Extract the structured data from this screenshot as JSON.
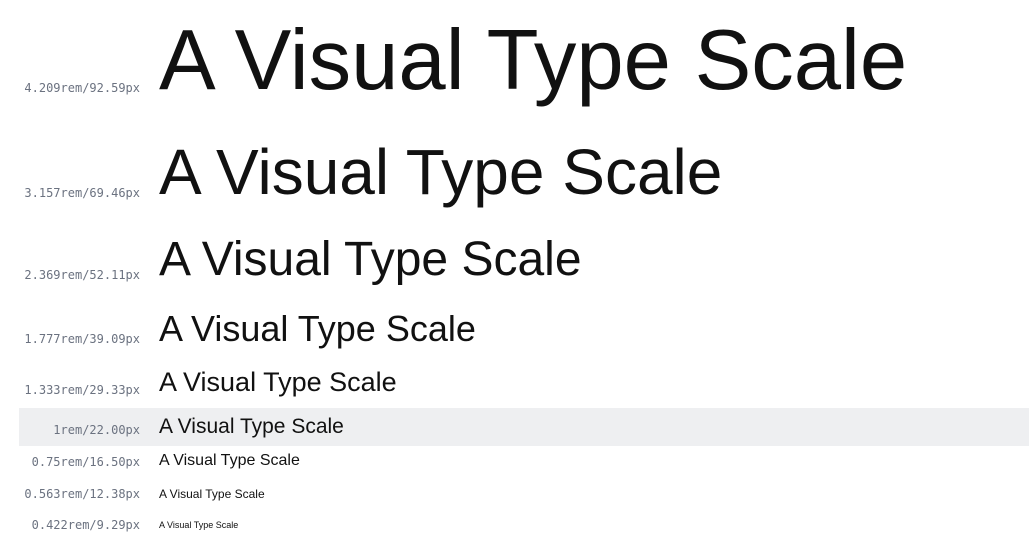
{
  "sample_text": "A Visual Type Scale",
  "steps": [
    {
      "label": "4.209rem/92.59px"
    },
    {
      "label": "3.157rem/69.46px"
    },
    {
      "label": "2.369rem/52.11px"
    },
    {
      "label": "1.777rem/39.09px"
    },
    {
      "label": "1.333rem/29.33px"
    },
    {
      "label": "1rem/22.00px"
    },
    {
      "label": "0.75rem/16.50px"
    },
    {
      "label": "0.563rem/12.38px"
    },
    {
      "label": "0.422rem/9.29px"
    }
  ],
  "colors": {
    "label": "#6b7280",
    "sample": "#111111",
    "base_highlight": "#eeeff1"
  }
}
